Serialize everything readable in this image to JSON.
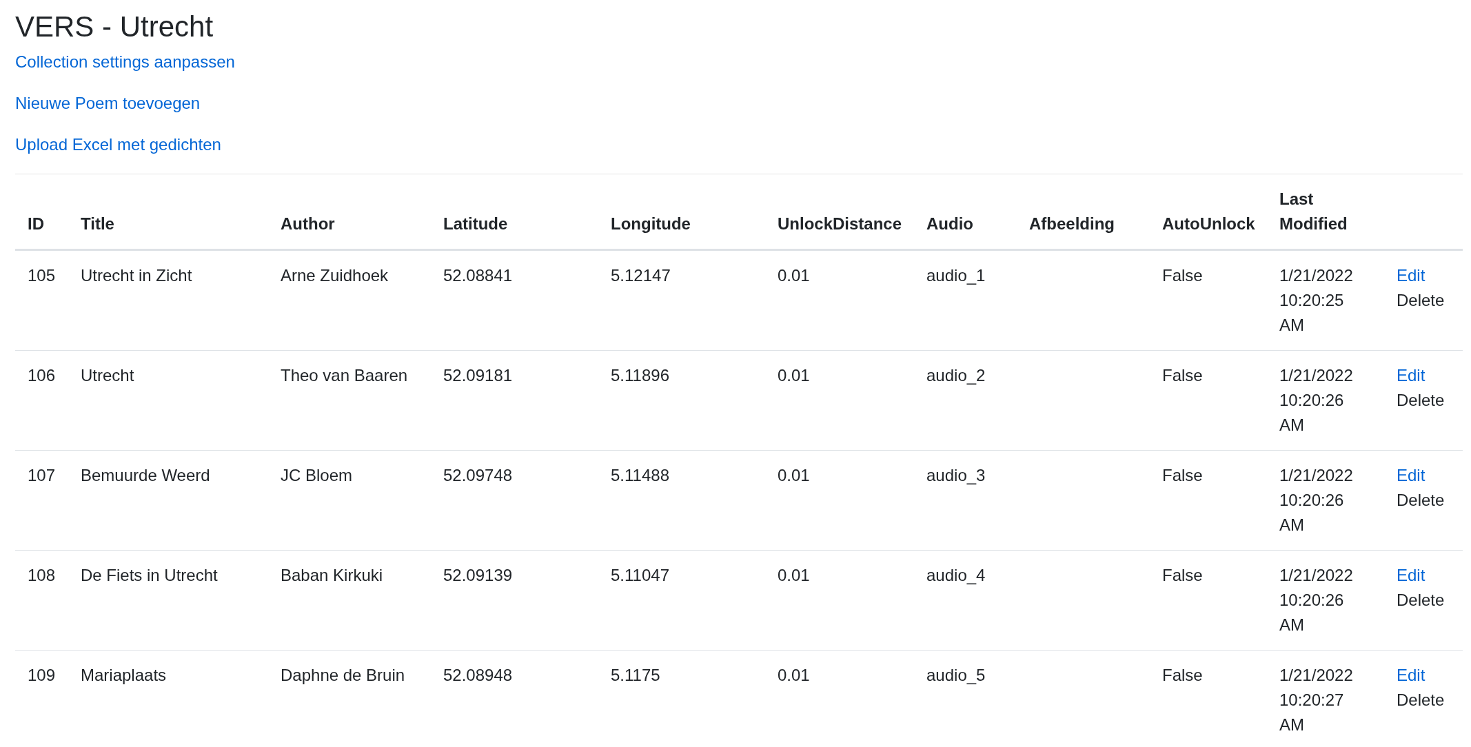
{
  "title": "VERS - Utrecht",
  "links": [
    "Collection settings aanpassen",
    "Nieuwe Poem toevoegen",
    "Upload Excel met gedichten"
  ],
  "table": {
    "columns": [
      "ID",
      "Title",
      "Author",
      "Latitude",
      "Longitude",
      "UnlockDistance",
      "Audio",
      "Afbeelding",
      "AutoUnlock",
      "Last Modified"
    ],
    "rows": [
      {
        "cells": [
          "105",
          "Utrecht in Zicht",
          "Arne Zuidhoek",
          "52.08841",
          "5.12147",
          "0.01",
          "audio_1",
          "",
          "False",
          "1/21/2022 10:20:25 AM"
        ],
        "actions": [
          "Edit",
          "Delete"
        ]
      },
      {
        "cells": [
          "106",
          "Utrecht",
          "Theo van Baaren",
          "52.09181",
          "5.11896",
          "0.01",
          "audio_2",
          "",
          "False",
          "1/21/2022 10:20:26 AM"
        ],
        "actions": [
          "Edit",
          "Delete"
        ]
      },
      {
        "cells": [
          "107",
          "Bemuurde Weerd",
          "JC Bloem",
          "52.09748",
          "5.11488",
          "0.01",
          "audio_3",
          "",
          "False",
          "1/21/2022 10:20:26 AM"
        ],
        "actions": [
          "Edit",
          "Delete"
        ]
      },
      {
        "cells": [
          "108",
          "De Fiets in Utrecht",
          "Baban Kirkuki",
          "52.09139",
          "5.11047",
          "0.01",
          "audio_4",
          "",
          "False",
          "1/21/2022 10:20:26 AM"
        ],
        "actions": [
          "Edit",
          "Delete"
        ]
      },
      {
        "cells": [
          "109",
          "Mariaplaats",
          "Daphne de Bruin",
          "52.08948",
          "5.1175",
          "0.01",
          "audio_5",
          "",
          "False",
          "1/21/2022 10:20:27 AM"
        ],
        "actions": [
          "Edit",
          "Delete"
        ]
      }
    ]
  }
}
